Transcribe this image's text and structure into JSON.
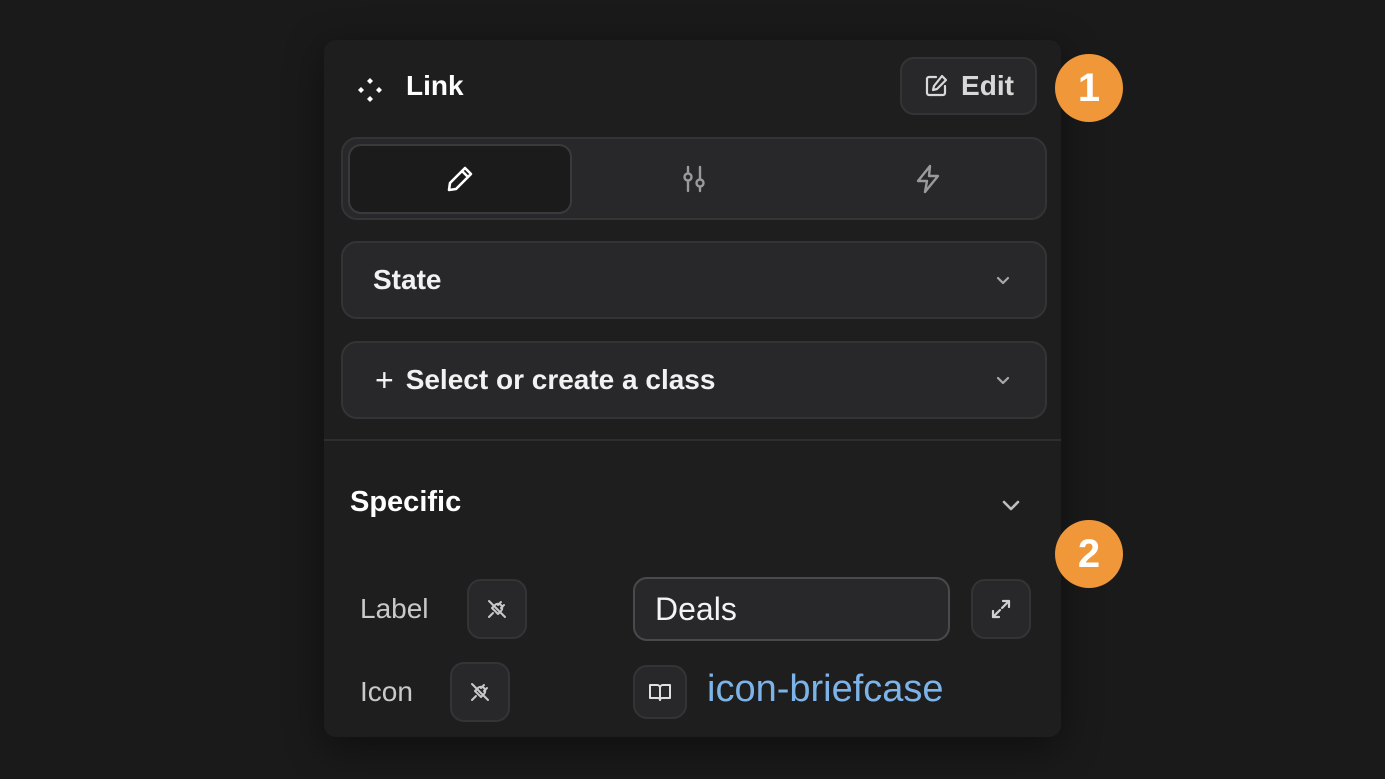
{
  "header": {
    "title": "Link",
    "edit_label": "Edit"
  },
  "tabs": [
    {
      "icon": "pencil-icon",
      "active": true
    },
    {
      "icon": "sliders-icon",
      "active": false
    },
    {
      "icon": "lightning-icon",
      "active": false
    }
  ],
  "state_select": {
    "label": "State"
  },
  "class_select": {
    "plus": "+",
    "label": "Select or create a class"
  },
  "section": {
    "title": "Specific"
  },
  "fields": {
    "label": {
      "name": "Label",
      "value": "Deals"
    },
    "icon": {
      "name": "Icon",
      "value": "icon-briefcase"
    }
  },
  "badges": [
    "1",
    "2"
  ],
  "colors": {
    "background": "#1a1a1a",
    "panel": "#1e1e1f",
    "control": "#28282a",
    "link": "#7cb3e8",
    "badge": "#f0973a"
  }
}
